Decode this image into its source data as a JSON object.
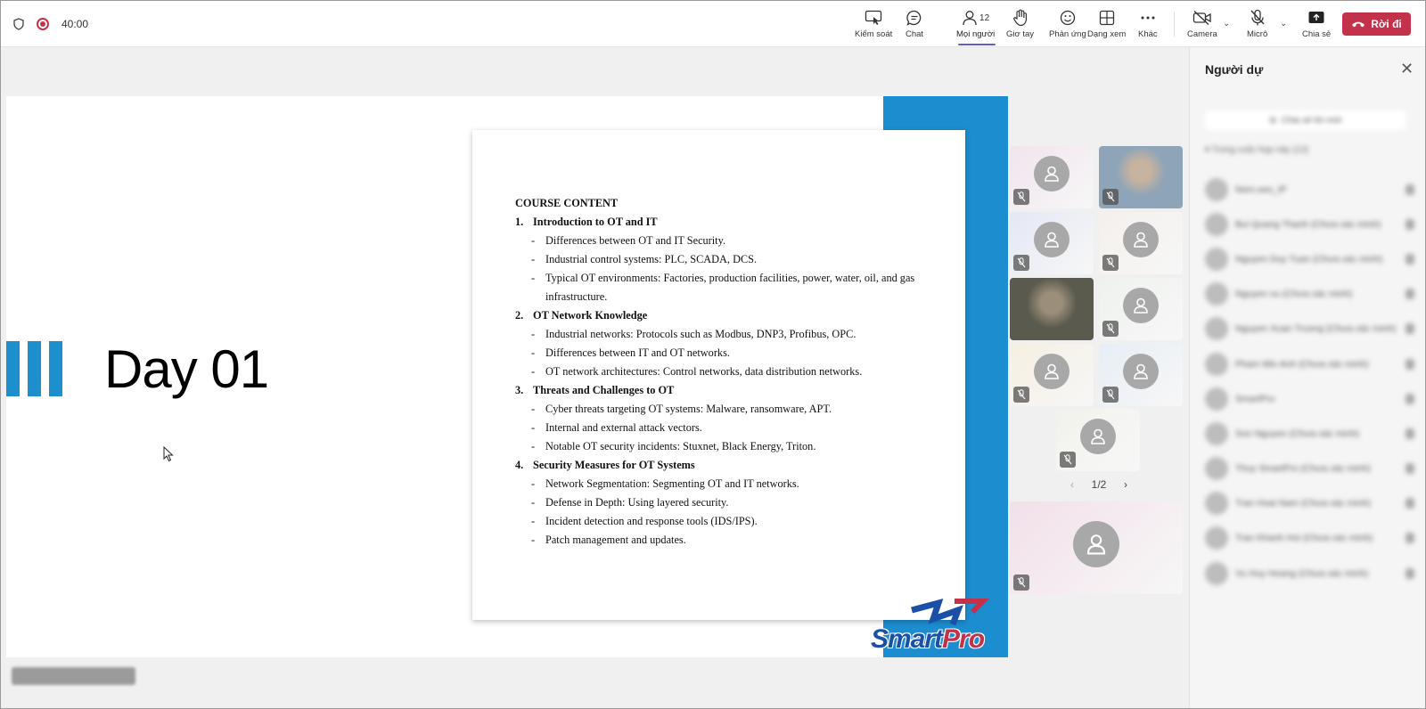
{
  "meeting": {
    "timer": "40:00"
  },
  "toolbar": {
    "control_label": "Kiểm soát",
    "chat_label": "Chat",
    "people_label": "Mọi người",
    "people_count": "12",
    "raise_hand_label": "Giơ tay",
    "react_label": "Phản ứng",
    "view_label": "Dạng xem",
    "more_label": "Khác",
    "camera_label": "Camera",
    "mic_label": "Micrô",
    "share_label": "Chia sẻ",
    "leave_label": "Rời đi"
  },
  "slide": {
    "day_title": "Day 01",
    "logo": "SmartPro",
    "document": {
      "heading": "COURSE CONTENT",
      "sections": [
        {
          "number": "1.",
          "title": "Introduction to OT and IT",
          "bullets": [
            "Differences between OT and IT Security.",
            "Industrial control systems: PLC, SCADA, DCS.",
            "Typical OT environments: Factories, production facilities, power, water, oil, and gas infrastructure."
          ]
        },
        {
          "number": "2.",
          "title": "OT Network Knowledge",
          "bullets": [
            "Industrial networks: Protocols such as Modbus, DNP3, Profibus, OPC.",
            "Differences between IT and OT networks.",
            "OT network architectures: Control networks, data distribution networks."
          ]
        },
        {
          "number": "3.",
          "title": "Threats and Challenges to OT",
          "bullets": [
            "Cyber threats targeting OT systems: Malware, ransomware, APT.",
            "Internal and external attack vectors.",
            "Notable OT security incidents: Stuxnet, Black Energy, Triton."
          ]
        },
        {
          "number": "4.",
          "title": "Security Measures for OT Systems",
          "bullets": [
            "Network Segmentation: Segmenting OT and IT networks.",
            "Defense in Depth: Using layered security.",
            "Incident detection and response tools (IDS/IPS).",
            "Patch management and updates."
          ]
        }
      ]
    }
  },
  "gallery": {
    "pager": "1/2"
  },
  "panel": {
    "title": "Người dự",
    "share_invite": "Chia sẻ lời mời",
    "group_label": "Trong cuộc họp này (12)",
    "participants": [
      "Nem.seo_IP",
      "Bui Quang Thanh (Chưa xác minh)",
      "Nguyen Duy Tuan (Chưa xác minh)",
      "Nguyen vu (Chưa xác minh)",
      "Nguyen Xuan Truong (Chưa xác minh)",
      "Pham Min Anh (Chưa xác minh)",
      "SmartPro",
      "Son Nguyen (Chưa xác minh)",
      "Thuy SmartPro (Chưa xác minh)",
      "Tran Hoai Nam (Chưa xác minh)",
      "Tran Khanh Hoi (Chưa xác minh)",
      "Vu Huy Hoang (Chưa xác minh)"
    ]
  },
  "colors": {
    "accent": "#1c8dcf",
    "leave": "#c4314b",
    "active_tab": "#5b5fc7"
  }
}
